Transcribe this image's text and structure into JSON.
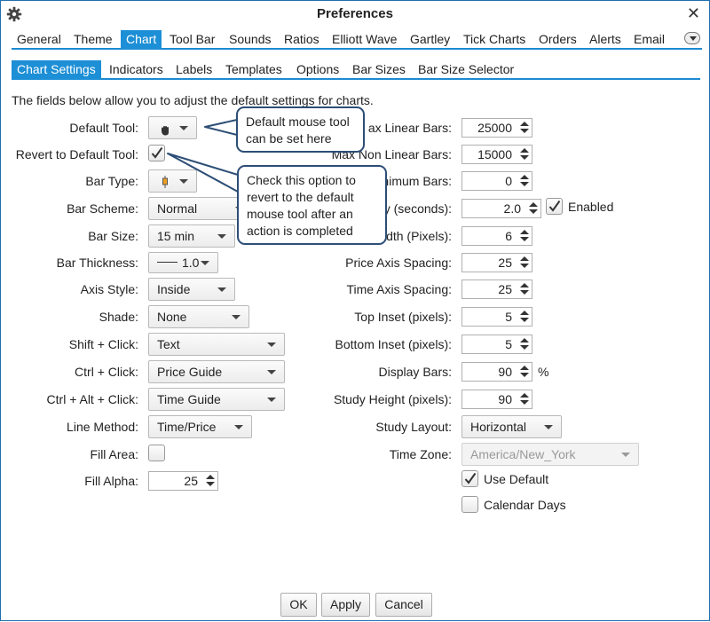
{
  "window": {
    "title": "Preferences",
    "close_glyph": "✕",
    "icon": "gear-icon"
  },
  "main_tabs": [
    "General",
    "Theme",
    "Chart",
    "Tool Bar",
    "Sounds",
    "Ratios",
    "Elliott Wave",
    "Gartley",
    "Tick Charts",
    "Orders",
    "Alerts",
    "Email"
  ],
  "main_tabs_active": "Chart",
  "sub_tabs": [
    "Chart Settings",
    "Indicators",
    "Labels",
    "Templates",
    "Options",
    "Bar Sizes",
    "Bar Size Selector"
  ],
  "sub_tabs_active": "Chart Settings",
  "intro": "The fields below allow you to adjust the default settings for charts.",
  "left": {
    "default_tool_label": "Default Tool:",
    "default_tool_icon": "hand-icon",
    "revert_label": "Revert to Default Tool:",
    "revert_checked": true,
    "bar_type_label": "Bar Type:",
    "bar_type_icon": "candlestick-icon",
    "bar_scheme_label": "Bar Scheme:",
    "bar_scheme_value": "Normal",
    "bar_size_label": "Bar Size:",
    "bar_size_value": "15 min",
    "bar_thickness_label": "Bar Thickness:",
    "bar_thickness_value": "1.0",
    "axis_style_label": "Axis Style:",
    "axis_style_value": "Inside",
    "shade_label": "Shade:",
    "shade_value": "None",
    "shift_click_label": "Shift + Click:",
    "shift_click_value": "Text",
    "ctrl_click_label": "Ctrl + Click:",
    "ctrl_click_value": "Price Guide",
    "ctrl_alt_click_label": "Ctrl + Alt + Click:",
    "ctrl_alt_click_value": "Time Guide",
    "line_method_label": "Line Method:",
    "line_method_value": "Time/Price",
    "fill_area_label": "Fill Area:",
    "fill_area_checked": false,
    "fill_alpha_label": "Fill Alpha:",
    "fill_alpha_value": "25"
  },
  "right": {
    "max_linear_label": "ax Linear Bars:",
    "max_linear_value": "25000",
    "max_nonlinear_label": "Max Non Linear Bars:",
    "max_nonlinear_value": "15000",
    "minimum_label": "nimum Bars:",
    "minimum_value": "0",
    "delay_label": "y (seconds):",
    "delay_value": "2.0",
    "delay_enabled_label": "Enabled",
    "delay_enabled_checked": true,
    "width_label": "idth (Pixels):",
    "width_value": "6",
    "price_axis_label": "Price Axis Spacing:",
    "price_axis_value": "25",
    "time_axis_label": "Time Axis Spacing:",
    "time_axis_value": "25",
    "top_inset_label": "Top Inset (pixels):",
    "top_inset_value": "5",
    "bottom_inset_label": "Bottom Inset (pixels):",
    "bottom_inset_value": "5",
    "display_bars_label": "Display Bars:",
    "display_bars_value": "90",
    "display_bars_unit": "%",
    "study_height_label": "Study Height (pixels):",
    "study_height_value": "90",
    "study_layout_label": "Study Layout:",
    "study_layout_value": "Horizontal",
    "time_zone_label": "Time Zone:",
    "time_zone_value": "America/New_York",
    "use_default_label": "Use Default",
    "use_default_checked": true,
    "calendar_days_label": "Calendar Days",
    "calendar_days_checked": false
  },
  "callouts": {
    "default_tool": "Default mouse tool can be set here",
    "revert": "Check this option to revert to the default mouse tool after an action is completed"
  },
  "buttons": {
    "ok": "OK",
    "apply": "Apply",
    "cancel": "Cancel"
  },
  "colors": {
    "accent": "#1d8fd6",
    "callout_border": "#2d4e76",
    "window_border": "#1f6fb0"
  }
}
